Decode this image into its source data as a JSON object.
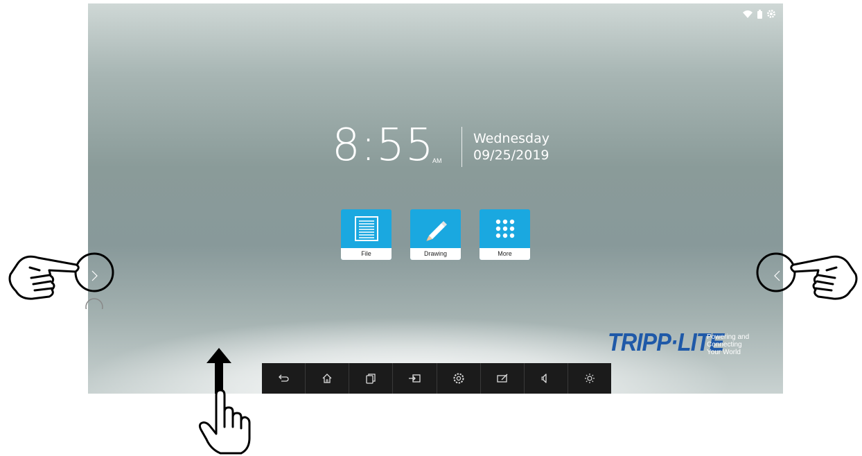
{
  "clock": {
    "time": "8:55",
    "ampm": "AM",
    "day": "Wednesday",
    "date": "09/25/2019"
  },
  "apps": [
    {
      "label": "File",
      "icon": "file-icon"
    },
    {
      "label": "Drawing",
      "icon": "pencil-icon"
    },
    {
      "label": "More",
      "icon": "grid-icon"
    }
  ],
  "status_bar": {
    "icons": [
      "wifi-icon",
      "battery-icon",
      "gear-icon"
    ]
  },
  "logo": {
    "brand": "TRIPP·LITE",
    "tagline_1": "Powering and",
    "tagline_2": "Connecting",
    "tagline_3": "Your World",
    "color": "#1f59a8"
  },
  "dock": {
    "buttons": [
      "back-icon",
      "home-icon",
      "windows-icon",
      "input-source-icon",
      "settings-icon",
      "whiteboard-icon",
      "volume-icon",
      "brightness-icon"
    ]
  },
  "colors": {
    "app_tile": "#1aa8e0",
    "dock": "#1b1b1b"
  }
}
